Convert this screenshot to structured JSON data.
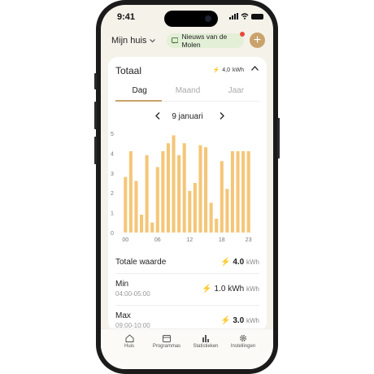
{
  "status": {
    "time": "9:41"
  },
  "header": {
    "home_label": "Mijn huis",
    "news_label": "Nieuws van de Molen",
    "add_symbol": "+"
  },
  "card": {
    "title": "Totaal",
    "total_value": "4,0",
    "total_unit": "kWh",
    "tabs": [
      "Dag",
      "Maand",
      "Jaar"
    ],
    "active_tab": "Dag",
    "date": "9 januari"
  },
  "chart_data": {
    "type": "bar",
    "x": [
      0,
      1,
      2,
      3,
      4,
      5,
      6,
      7,
      8,
      9,
      10,
      11,
      12,
      13,
      14,
      15,
      16,
      17,
      18,
      19,
      20,
      21,
      22,
      23
    ],
    "values": [
      2.8,
      4.1,
      2.6,
      0.9,
      3.9,
      0.5,
      3.3,
      4.1,
      4.5,
      4.9,
      3.9,
      4.5,
      2.1,
      2.5,
      4.4,
      4.3,
      1.5,
      0.7,
      3.6,
      2.2,
      4.1,
      4.1,
      4.1,
      4.1
    ],
    "x_tick_labels": [
      "00",
      "06",
      "12",
      "18",
      "23"
    ],
    "y_tick_labels": [
      "0",
      "1",
      "2",
      "3",
      "4",
      "5"
    ],
    "ylim": [
      0,
      5
    ],
    "bar_color": "#f5c678"
  },
  "summary": {
    "total": {
      "label": "Totale waarde",
      "value": "4.0",
      "unit": "kWh"
    },
    "min": {
      "label": "Min",
      "time": "04:00-05:00",
      "value": "1.0 kWh",
      "unit": "kWh"
    },
    "max": {
      "label": "Max",
      "time": "09:00-10:00",
      "value": "3.0",
      "unit": "kWh"
    }
  },
  "tabbar": {
    "items": [
      {
        "label": "Huis",
        "icon": "home-icon"
      },
      {
        "label": "Programmas",
        "icon": "calendar-icon"
      },
      {
        "label": "Statistieken",
        "icon": "stats-icon"
      },
      {
        "label": "Instellingen",
        "icon": "gear-icon"
      }
    ]
  },
  "colors": {
    "accent": "#c9a36b",
    "bolt": "#e8793a",
    "news_bg": "#e3efd7",
    "bar": "#f5c678"
  }
}
